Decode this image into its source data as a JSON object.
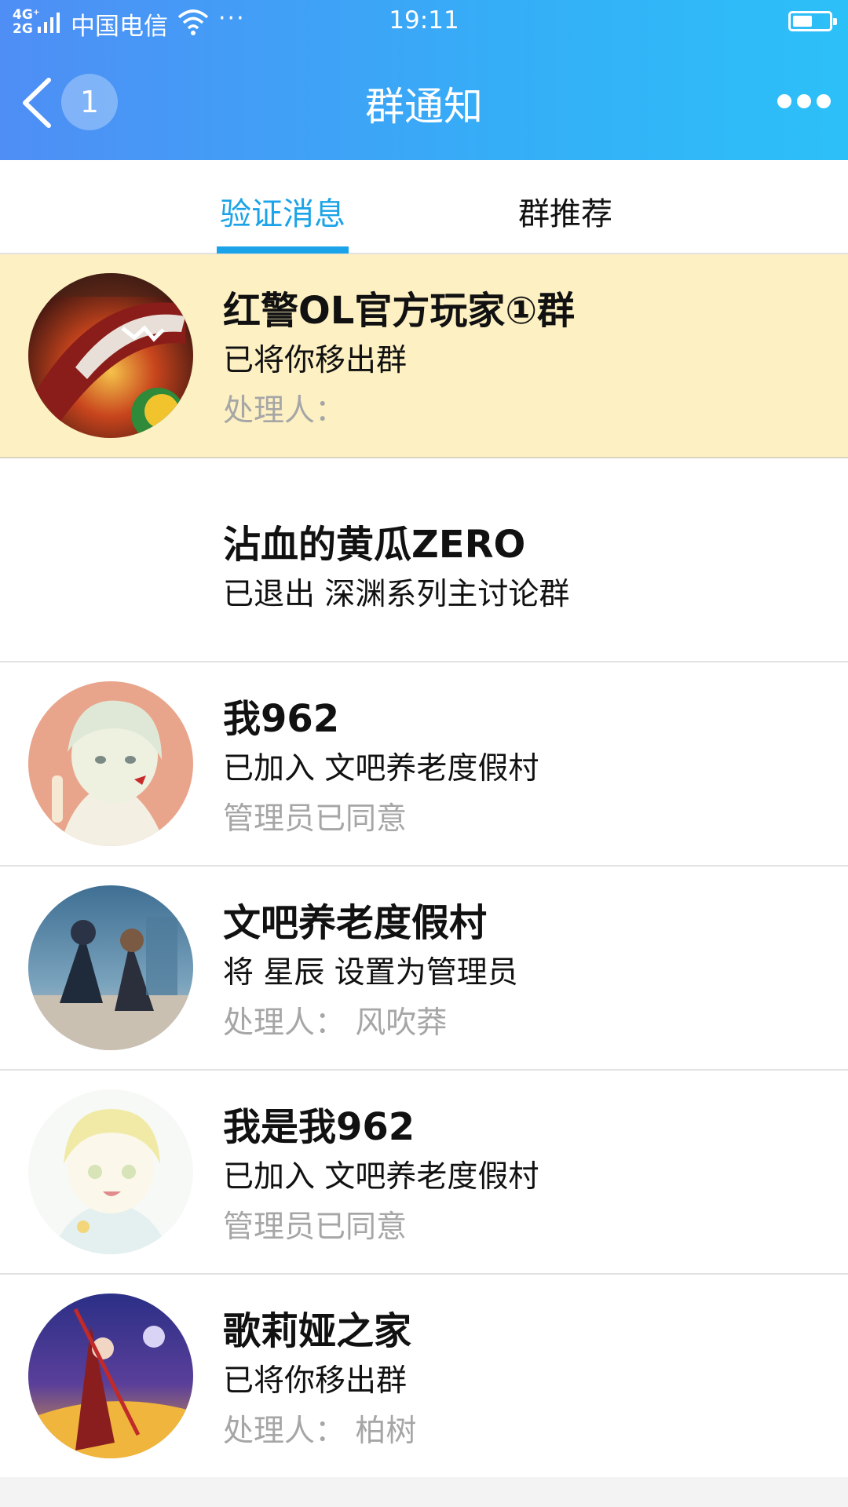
{
  "status_bar": {
    "network": "4G⁺\n2G",
    "carrier": "中国电信",
    "more": "···",
    "time": "19:11",
    "battery_level": 0.55
  },
  "nav": {
    "back_icon": "chevron-left-icon",
    "badge_count": "1",
    "title": "群通知",
    "more_icon": "more-dots-icon"
  },
  "tabs": [
    {
      "label": "验证消息",
      "active": true
    },
    {
      "label": "群推荐",
      "active": false
    }
  ],
  "colors": {
    "header_start": "#4f8ef5",
    "header_end": "#2cc0f8",
    "accent": "#1aa3e8",
    "highlight_row": "#fdf0c3"
  },
  "notifications": [
    {
      "title": "红警OL官方玩家①群",
      "subtitle": "已将你移出群",
      "handler": "处理人：",
      "avatar": "game-avatar-redalert",
      "highlight": true
    },
    {
      "title": "沾血的黄瓜ZERO",
      "subtitle": "已退出 深渊系列主讨论群",
      "handler": "",
      "avatar": "",
      "highlight": false
    },
    {
      "title": "我962",
      "subtitle": "已加入 文吧养老度假村",
      "handler": "管理员已同意",
      "avatar": "anime-avatar-white-hair",
      "highlight": false
    },
    {
      "title": "文吧养老度假村",
      "subtitle": "将 星辰 设置为管理员",
      "handler": "处理人： 风吹莽",
      "avatar": "anime-avatar-group",
      "highlight": false
    },
    {
      "title": "我是我962",
      "subtitle": "已加入 文吧养老度假村",
      "handler": "管理员已同意",
      "avatar": "anime-avatar-blond",
      "highlight": false
    },
    {
      "title": "歌莉娅之家",
      "subtitle": "已将你移出群",
      "handler": "处理人： 柏树",
      "avatar": "anime-avatar-warrior",
      "highlight": false
    }
  ]
}
